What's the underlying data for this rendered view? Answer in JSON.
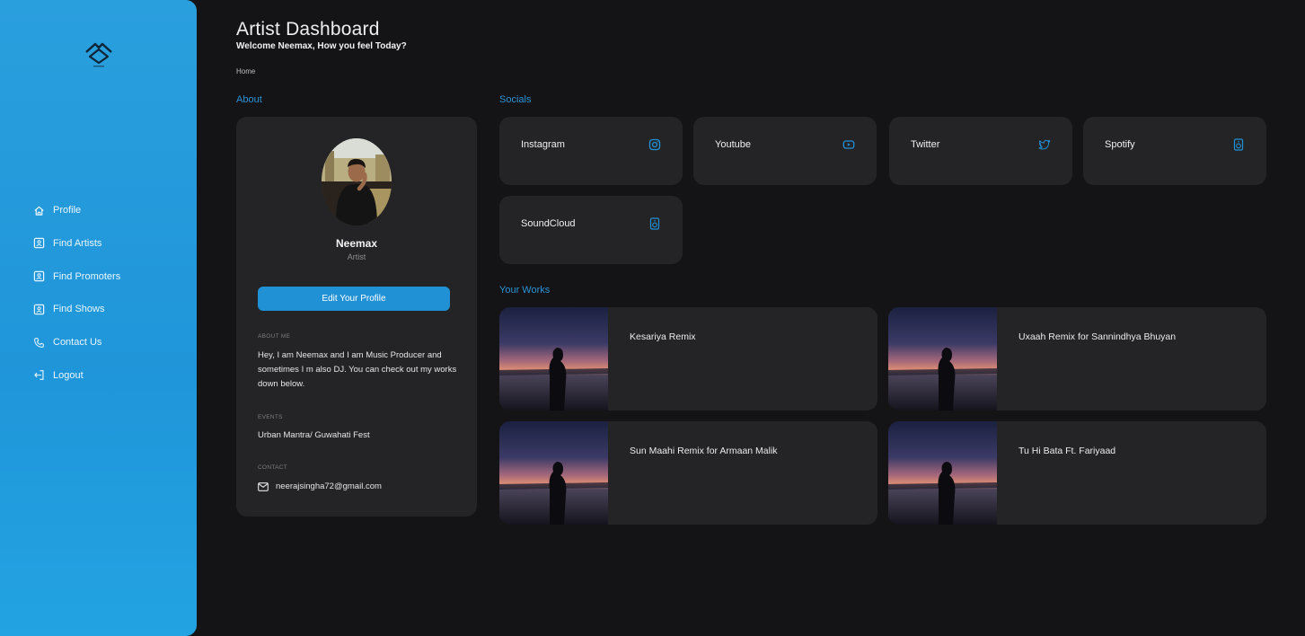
{
  "app": {
    "title": "Artist Dashboard",
    "subtitle": "Welcome Neemax, How you feel Today?",
    "breadcrumb": "Home",
    "accent_color": "#2191d6",
    "sidebar_color": "#1f96d9",
    "background_color": "#141416",
    "card_color": "#242427"
  },
  "sidebar": {
    "logo_icon": "brand-logo-icon",
    "items": [
      {
        "label": "Profile",
        "icon": "home-icon"
      },
      {
        "label": "Find Artists",
        "icon": "contact-card-icon"
      },
      {
        "label": "Find Promoters",
        "icon": "contact-card-icon"
      },
      {
        "label": "Find Shows",
        "icon": "contact-card-icon"
      },
      {
        "label": "Contact Us",
        "icon": "phone-icon"
      },
      {
        "label": "Logout",
        "icon": "logout-icon"
      }
    ]
  },
  "about": {
    "section_label": "About",
    "name": "Neemax",
    "role": "Artist",
    "edit_button": "Edit Your Profile",
    "about_me_label": "ABOUT ME",
    "about_me_text": "Hey, I am Neemax and I am Music Producer and sometimes I m also DJ. You can check out my works down below.",
    "events_label": "EVENTS",
    "events_text": "Urban Mantra/ Guwahati Fest",
    "contact_label": "CONTACT",
    "contact_email": "neerajsingha72@gmail.com"
  },
  "socials": {
    "section_label": "Socials",
    "items": [
      {
        "name": "Instagram",
        "icon": "instagram-icon"
      },
      {
        "name": "Youtube",
        "icon": "youtube-icon"
      },
      {
        "name": "Twitter",
        "icon": "twitter-icon"
      },
      {
        "name": "Spotify",
        "icon": "speaker-icon"
      },
      {
        "name": "SoundCloud",
        "icon": "speaker-icon"
      }
    ]
  },
  "works": {
    "section_label": "Your Works",
    "items": [
      {
        "title": "Kesariya Remix"
      },
      {
        "title": "Uxaah Remix for Sannindhya Bhuyan"
      },
      {
        "title": "Sun Maahi Remix for Armaan Malik"
      },
      {
        "title": "Tu Hi Bata Ft. Fariyaad"
      }
    ]
  }
}
